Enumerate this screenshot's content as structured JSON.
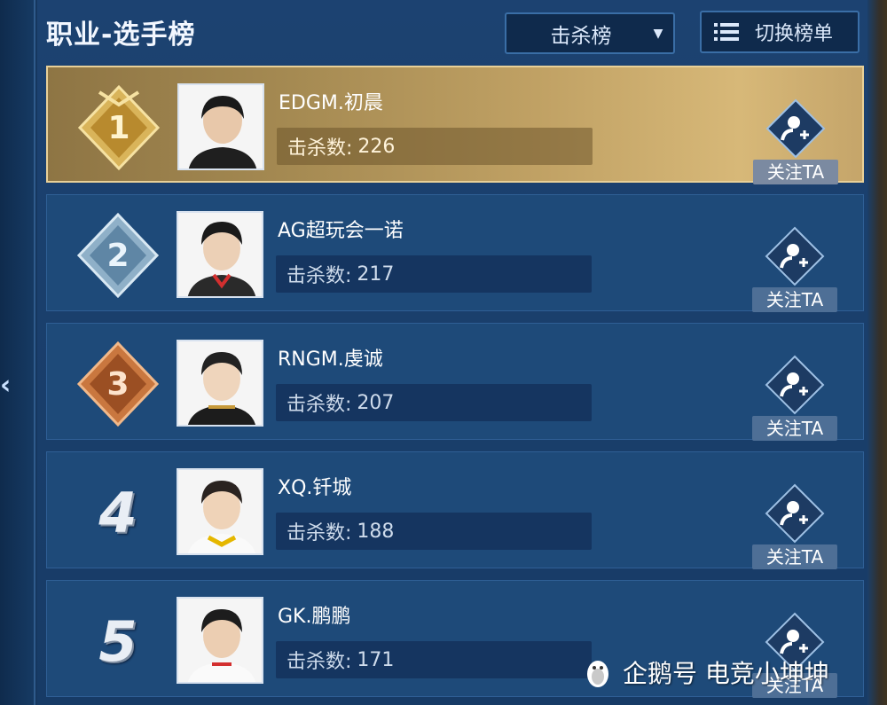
{
  "header": {
    "title": "职业-选手榜",
    "dropdown_value": "击杀榜",
    "switch_label": "切换榜单"
  },
  "kills_label": "击杀数:",
  "follow_label": "关注TA",
  "players": [
    {
      "rank": "1",
      "name": "EDGM.初晨",
      "kills": "226",
      "badge": "gold-medal-icon"
    },
    {
      "rank": "2",
      "name": "AG超玩会一诺",
      "kills": "217",
      "badge": "silver-medal-icon"
    },
    {
      "rank": "3",
      "name": "RNGM.虔诚",
      "kills": "207",
      "badge": "bronze-medal-icon"
    },
    {
      "rank": "4",
      "name": "XQ.钎城",
      "kills": "188"
    },
    {
      "rank": "5",
      "name": "GK.鹏鹏",
      "kills": "171"
    }
  ],
  "watermark": "企鹅号 电竞小坤坤",
  "colors": {
    "panel": "#1c4271",
    "row": "#1e4a79",
    "gold_row": "#c0a164",
    "follow_icon": "#1d3b63",
    "follow_button": "#4e6f96"
  }
}
